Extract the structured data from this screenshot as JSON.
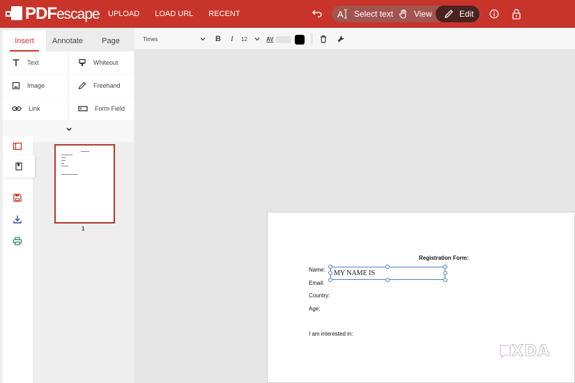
{
  "app": {
    "logo_pdf": "PDF",
    "logo_rest": "escape"
  },
  "topnav": {
    "upload": "UPLOAD",
    "load_url": "LOAD URL",
    "recent": "RECENT"
  },
  "modes": {
    "select_text": "Select text",
    "view": "View",
    "edit": "Edit"
  },
  "tabs": {
    "insert": "Insert",
    "annotate": "Annotate",
    "page": "Page"
  },
  "tools": {
    "text": "Text",
    "whiteout": "Whiteout",
    "image": "Image",
    "freehand": "Freehand",
    "link": "Link",
    "form_field": "Form Field"
  },
  "format": {
    "font": "Times",
    "bold": "B",
    "italic": "I",
    "size": "12",
    "char_spacing": "AV",
    "text_color": "#000000"
  },
  "thumbnail": {
    "page_number": "1"
  },
  "document": {
    "title": "Registration Form:",
    "name_label": "Name:",
    "email_label": "Email:",
    "country_label": "Country:",
    "age_label": "Age:",
    "interest_label": "I am interested in:",
    "name_value": "MY NAME IS"
  },
  "watermark": {
    "text": "XDA"
  },
  "colors": {
    "brand": "#c8342a",
    "selection": "#4f7fc4"
  }
}
